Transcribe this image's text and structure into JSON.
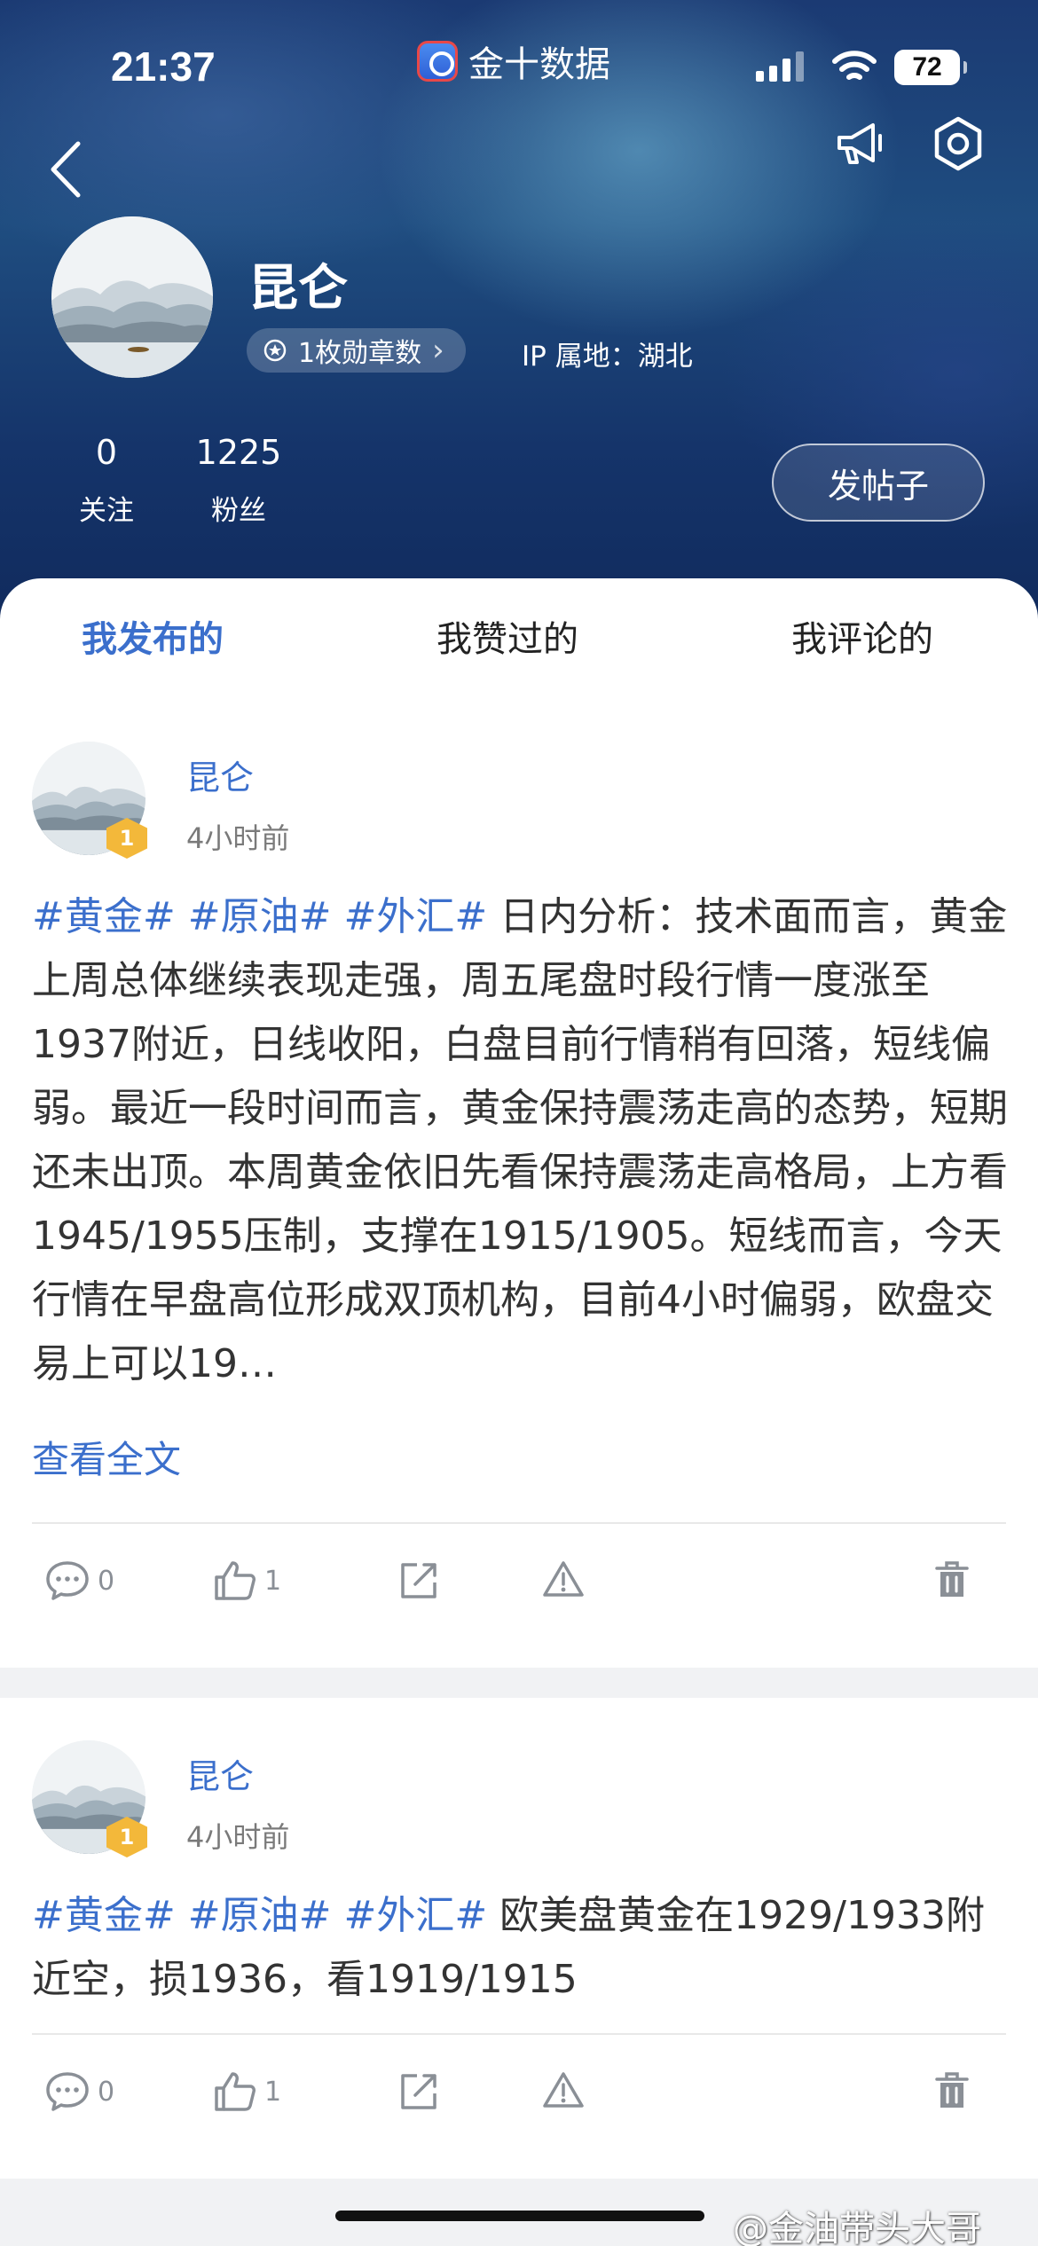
{
  "status_bar": {
    "time": "21:37",
    "app_name": "金十数据",
    "battery": "72"
  },
  "profile": {
    "name": "昆仑",
    "badge_text": "1枚勋章数",
    "badge_chevron": "›",
    "ip_location": "IP 属地：湖北",
    "following_count": "0",
    "following_label": "关注",
    "followers_count": "1225",
    "followers_label": "粉丝",
    "post_button": "发帖子"
  },
  "tabs": [
    {
      "label": "我发布的",
      "active": true
    },
    {
      "label": "我赞过的",
      "active": false
    },
    {
      "label": "我评论的",
      "active": false
    }
  ],
  "posts": [
    {
      "author": "昆仑",
      "level": "1",
      "time": "4小时前",
      "tags": [
        "#黄金#",
        "#原油#",
        "#外汇#"
      ],
      "body": " 日内分析：技术面而言，黄金上周总体继续表现走强，周五尾盘时段行情一度涨至1937附近，日线收阳，白盘目前行情稍有回落，短线偏弱。最近一段时间而言，黄金保持震荡走高的态势，短期还未出顶。本周黄金依旧先看保持震荡走高格局，上方看1945/1955压制，支撑在1915/1905。短线而言，今天行情在早盘高位形成双顶机构，目前4小时偏弱，欧盘交易上可以19…",
      "read_more": "查看全文",
      "comments": "0",
      "likes": "1"
    },
    {
      "author": "昆仑",
      "level": "1",
      "time": "4小时前",
      "tags": [
        "#黄金#",
        "#原油#",
        "#外汇#"
      ],
      "body": " 欧美盘黄金在1929/1933附近空，损1936，看1919/1915",
      "comments": "0",
      "likes": "1"
    }
  ],
  "watermark": "@金油带头大哥",
  "colors": {
    "accent": "#3b6fcc",
    "level_badge": "#f3b83a"
  }
}
